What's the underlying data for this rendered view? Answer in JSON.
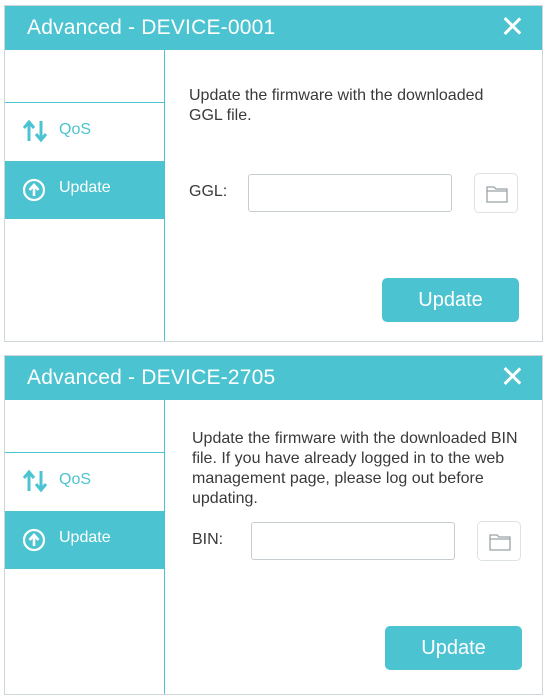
{
  "colors": {
    "accent": "#4cc3d0",
    "text": "#3a3a3a",
    "white": "#ffffff"
  },
  "dialogs": [
    {
      "title": "Advanced - DEVICE-0001",
      "sidebar": {
        "items": [
          {
            "label": "QoS",
            "icon": "qos-arrows-icon"
          },
          {
            "label": "Update",
            "icon": "upload-circle-icon",
            "active": true
          }
        ]
      },
      "description": "Update the firmware with the downloaded GGL file.",
      "field_label": "GGL:",
      "field_value": "",
      "browse_icon": "folder-icon",
      "button_label": "Update"
    },
    {
      "title": "Advanced - DEVICE-2705",
      "sidebar": {
        "items": [
          {
            "label": "QoS",
            "icon": "qos-arrows-icon"
          },
          {
            "label": "Update",
            "icon": "upload-circle-icon",
            "active": true
          }
        ]
      },
      "description": "Update the firmware with the downloaded BIN file. If you have already logged in to the web management page, please log out before updating.",
      "field_label": "BIN:",
      "field_value": "",
      "browse_icon": "folder-icon",
      "button_label": "Update"
    }
  ]
}
